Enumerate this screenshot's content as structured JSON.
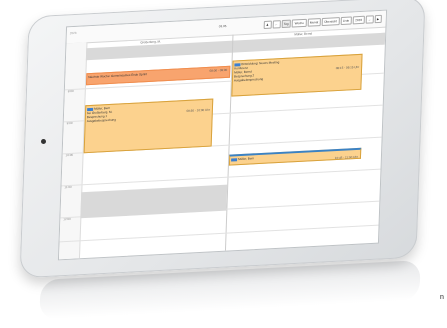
{
  "toolbar": {
    "year": "2023",
    "title": "03.05.",
    "buttons": [
      {
        "label": "♟"
      },
      {
        "label": "←"
      },
      {
        "label": "Tag"
      },
      {
        "label": "Woche"
      },
      {
        "label": "Monat"
      },
      {
        "label": "Übersicht"
      },
      {
        "label": "Liste"
      },
      {
        "label": "2023"
      },
      {
        "label": "→"
      },
      {
        "label": "▶"
      }
    ]
  },
  "columns": [
    {
      "label": "Großerberg, M."
    },
    {
      "label": "Müller, Bernd"
    }
  ],
  "times": [
    "8:00",
    "9:00",
    "10:00",
    "11:00",
    "12:00"
  ],
  "events": [
    {
      "name": "event-left-top",
      "lines": [
        "Nächste Woche: Gemeinsames Ende Sprint"
      ],
      "time": "08:00 - 09:00"
    },
    {
      "name": "event-left-mid",
      "lines": [
        "Müller, Bern",
        "bei Großerberg, M.",
        "Besprechung 1",
        "Ausgabebesprechung"
      ],
      "time": "09:30 - 10:30 Uhr"
    },
    {
      "name": "event-right-top",
      "lines": [
        "Entwicklung: Neues Meeting",
        "Konferenz",
        "Müller, Bernd",
        "Besprechung 2",
        "Ausgabebesprechung"
      ],
      "time": "08:15 - 09:15 Uhr"
    },
    {
      "name": "event-right-bottom",
      "lines": [
        "Müller, Bern"
      ],
      "time": "10:45 - 11:00 Uhr"
    }
  ],
  "caption": "n",
  "colors": {
    "orange": "#f8a46e",
    "yellow": "#fcd28e",
    "tag_blue": "#3b7fd1"
  }
}
